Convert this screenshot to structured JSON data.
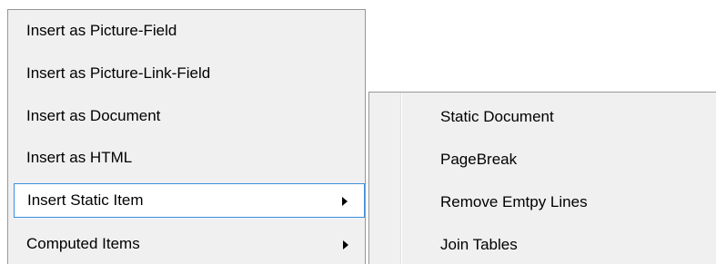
{
  "context_menu": {
    "items": [
      {
        "label": "Insert as Picture-Field",
        "has_submenu": false,
        "highlighted": false
      },
      {
        "label": "Insert as Picture-Link-Field",
        "has_submenu": false,
        "highlighted": false
      },
      {
        "label": "Insert as Document",
        "has_submenu": false,
        "highlighted": false
      },
      {
        "label": "Insert as HTML",
        "has_submenu": false,
        "highlighted": false
      },
      {
        "label": "Insert Static Item",
        "has_submenu": true,
        "highlighted": true
      },
      {
        "label": "Computed Items",
        "has_submenu": true,
        "highlighted": false
      }
    ]
  },
  "submenu": {
    "items": [
      {
        "label": "Static Document"
      },
      {
        "label": "PageBreak"
      },
      {
        "label": "Remove Emtpy Lines"
      },
      {
        "label": "Join Tables"
      }
    ]
  },
  "colors": {
    "menu_background": "#f0f0f0",
    "menu_border": "#979797",
    "highlight_border": "#3a8fdf",
    "highlight_background": "#ffffff",
    "text": "#000000"
  },
  "icons": {
    "submenu_arrow": "chevron-right-icon"
  }
}
